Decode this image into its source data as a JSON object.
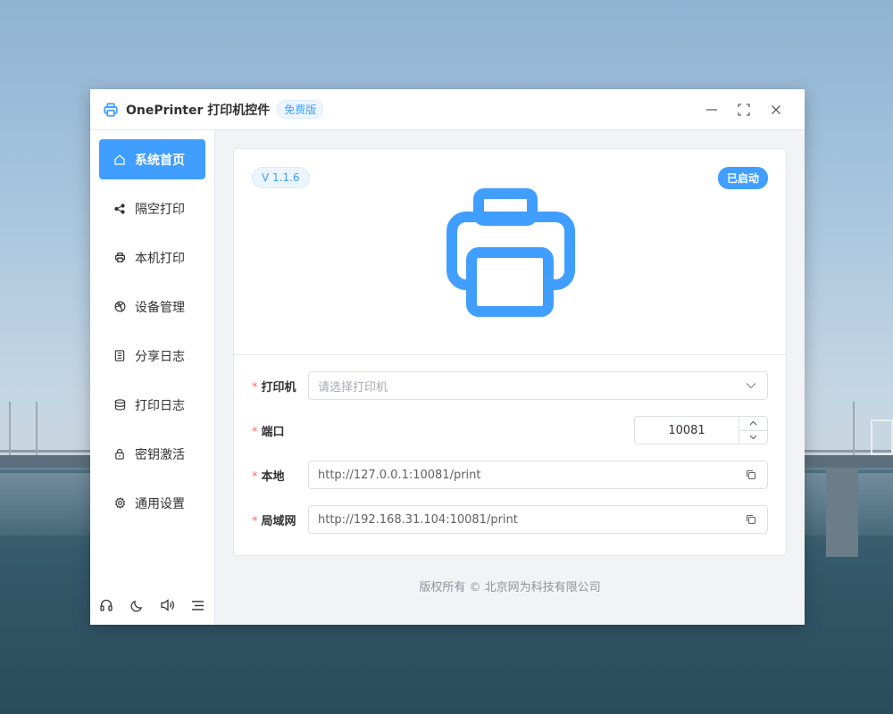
{
  "window": {
    "title": "OnePrinter 打印机控件",
    "edition_badge": "免费版",
    "icons": {
      "app": "printer-icon",
      "minimize": "minimize-icon",
      "maximize": "fullscreen-icon",
      "close": "close-icon"
    }
  },
  "sidebar": {
    "items": [
      {
        "label": "系统首页",
        "icon": "home-icon",
        "active": true
      },
      {
        "label": "隔空打印",
        "icon": "share-icon",
        "active": false
      },
      {
        "label": "本机打印",
        "icon": "printer-icon",
        "active": false
      },
      {
        "label": "设备管理",
        "icon": "dribbble-icon",
        "active": false
      },
      {
        "label": "分享日志",
        "icon": "document-icon",
        "active": false
      },
      {
        "label": "打印日志",
        "icon": "database-icon",
        "active": false
      },
      {
        "label": "密钥激活",
        "icon": "lock-icon",
        "active": false
      },
      {
        "label": "通用设置",
        "icon": "gear-icon",
        "active": false
      }
    ],
    "footer_icons": [
      "headset-icon",
      "moon-icon",
      "volume-icon",
      "menu-collapse-icon"
    ]
  },
  "main": {
    "version": "V 1.1.6",
    "status": "已启动",
    "form": {
      "printer_label": "打印机",
      "printer_placeholder": "请选择打印机",
      "port_label": "端口",
      "port_value": "10081",
      "local_label": "本地",
      "local_url": "http://127.0.0.1:10081/print",
      "lan_label": "局域网",
      "lan_url": "http://192.168.31.104:10081/print",
      "required_mark": "*"
    },
    "copyright": "版权所有 ©  北京网为科技有限公司"
  },
  "colors": {
    "accent": "#409eff",
    "required": "#f56c6c"
  }
}
